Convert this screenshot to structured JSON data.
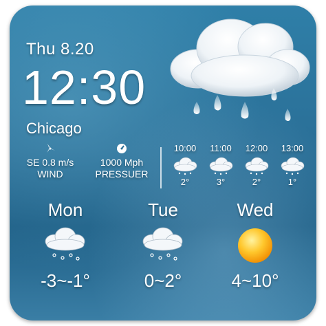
{
  "current": {
    "date": "Thu 8.20",
    "time": "12:30",
    "city": "Chicago",
    "icon": "rain-cloud-icon"
  },
  "stats": [
    {
      "value": "SE 0.8 m/s",
      "label": "WIND",
      "icon": "wind-icon"
    },
    {
      "value": "1000 Mph",
      "label": "PRESSUER",
      "icon": "pressure-gauge-icon"
    }
  ],
  "hourly": [
    {
      "time": "10:00",
      "temp": "2°",
      "icon": "snow-cloud-icon"
    },
    {
      "time": "11:00",
      "temp": "3°",
      "icon": "snow-cloud-icon"
    },
    {
      "time": "12:00",
      "temp": "2°",
      "icon": "snow-cloud-icon"
    },
    {
      "time": "13:00",
      "temp": "1°",
      "icon": "snow-cloud-icon"
    }
  ],
  "daily": [
    {
      "day": "Mon",
      "range": "-3~-1°",
      "icon": "snow-cloud-icon"
    },
    {
      "day": "Tue",
      "range": "0~2°",
      "icon": "snow-cloud-icon"
    },
    {
      "day": "Wed",
      "range": "4~10°",
      "icon": "sun-icon"
    }
  ],
  "colors": {
    "background_top": "#2f7fa8",
    "background_bottom": "#1e5f86",
    "sun": "#f5a623",
    "text": "#ffffff"
  }
}
